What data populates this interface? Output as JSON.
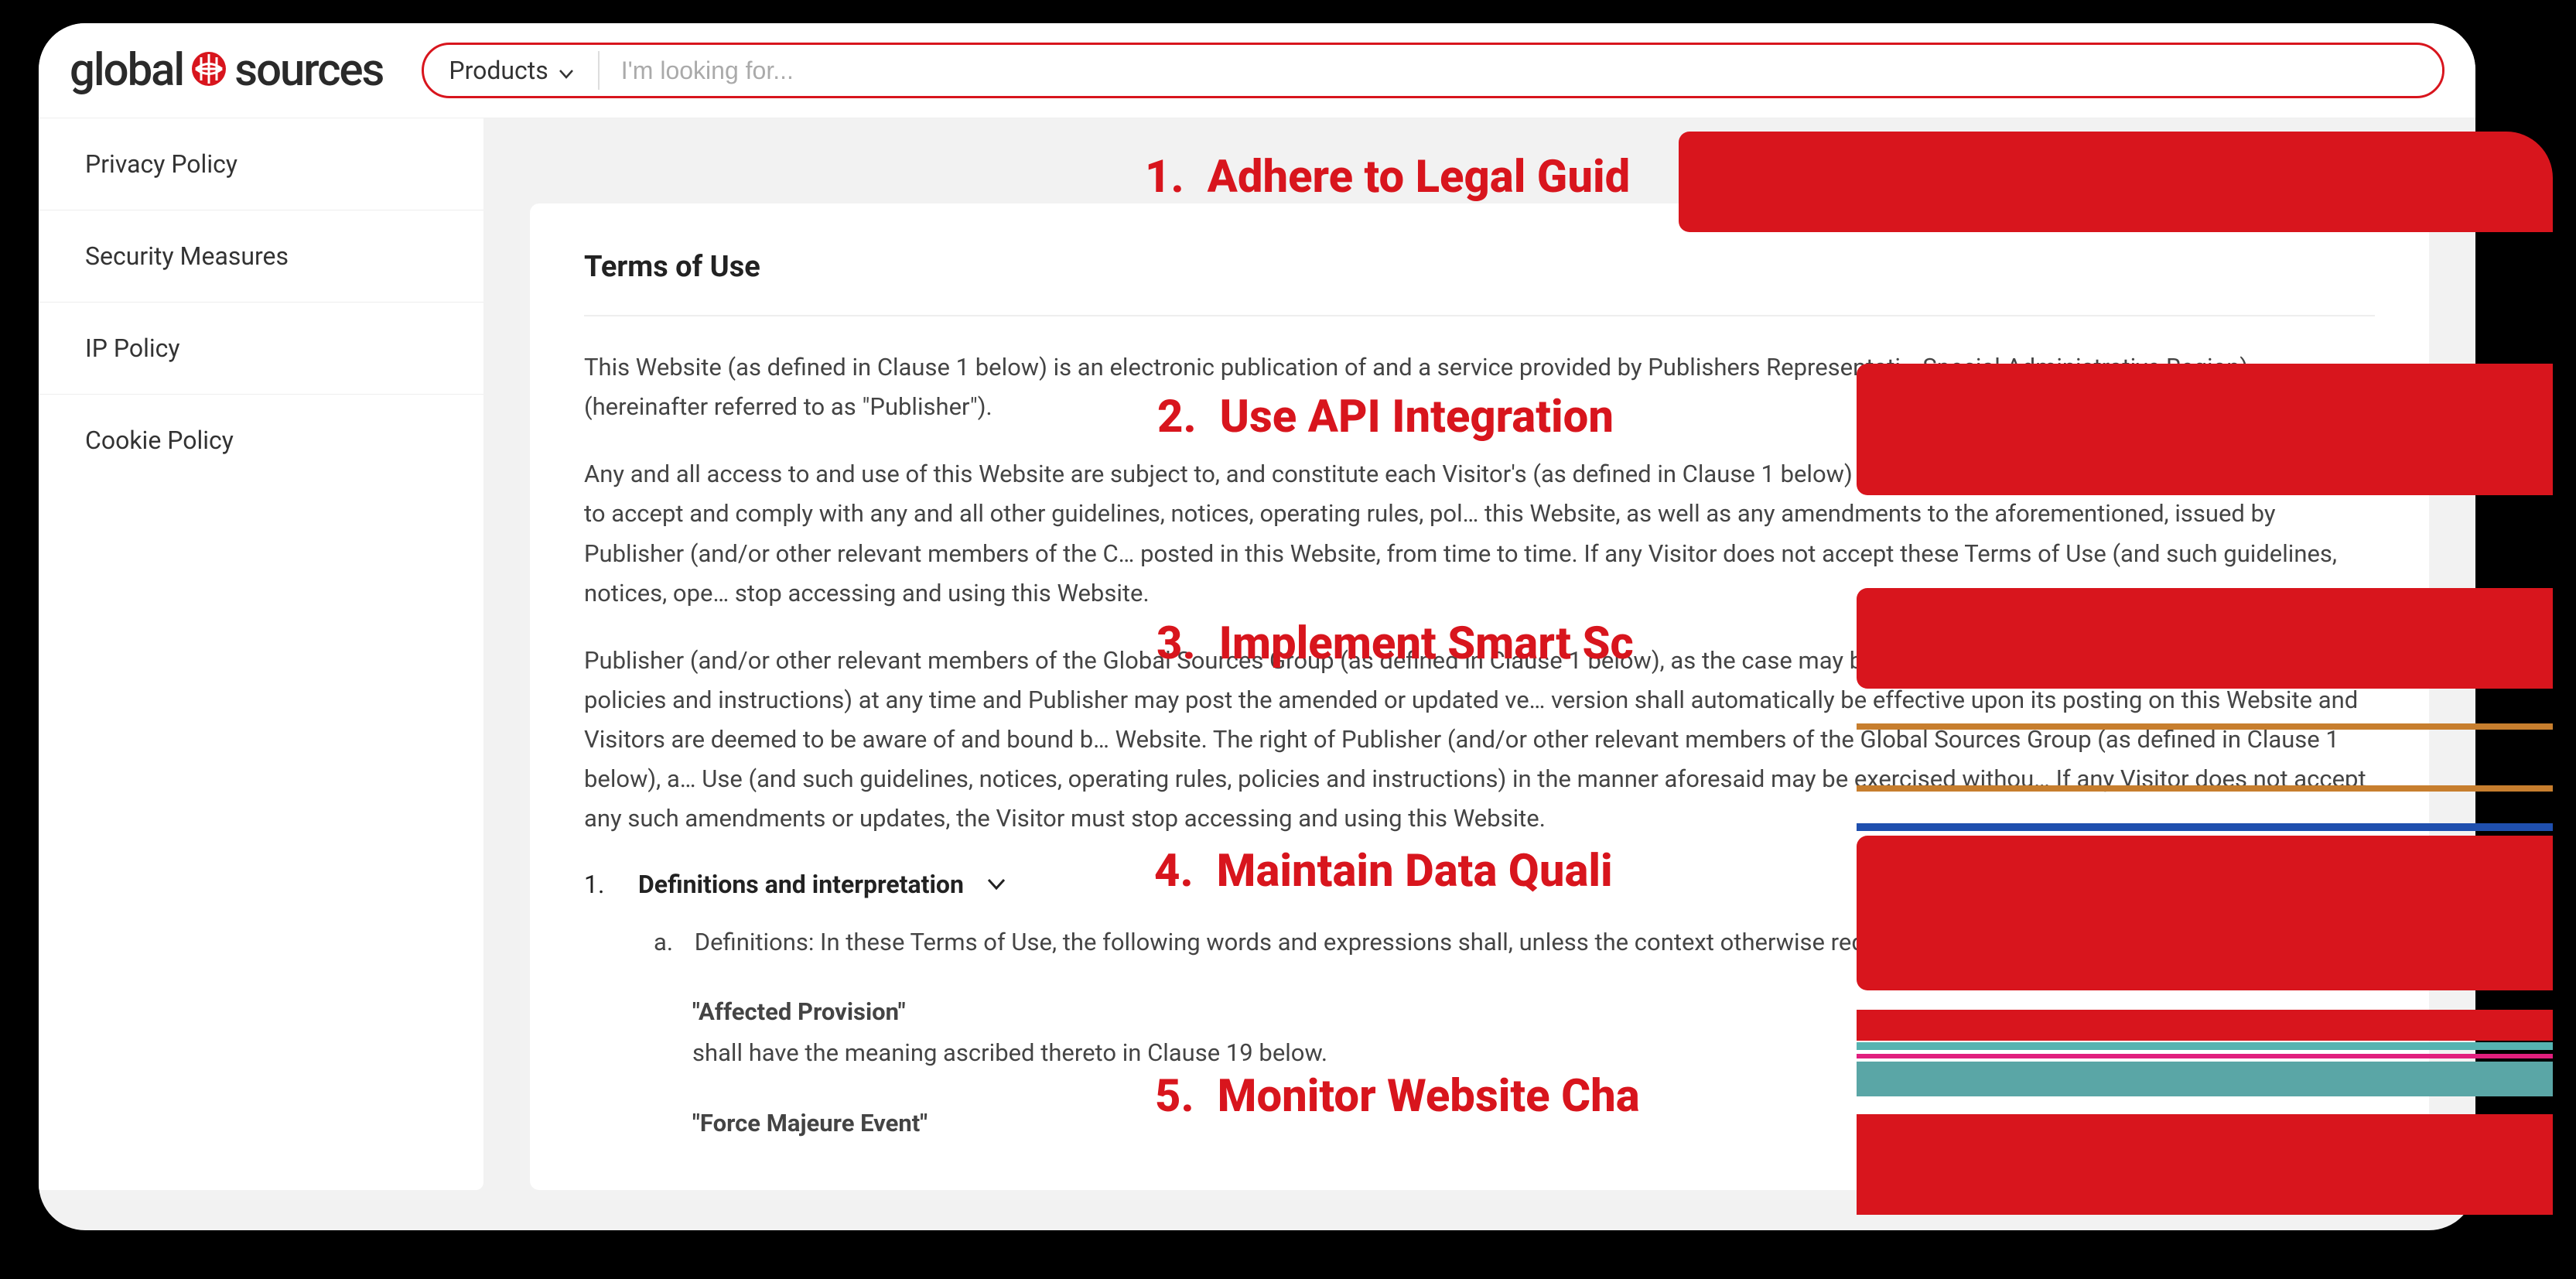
{
  "header": {
    "logo_global": "global",
    "logo_sources": "sources",
    "search_category": "Products",
    "search_placeholder": "I'm looking for..."
  },
  "sidebar": {
    "items": [
      "Privacy Policy",
      "Security Measures",
      "IP Policy",
      "Cookie Policy"
    ]
  },
  "card": {
    "title": "Terms of Use",
    "p1": "This Website (as defined in Clause 1 below) is an electronic publication of and a service provided by Publishers Representati… Special Administrative Region) (hereinafter referred to as \"Publisher\").",
    "p2": "Any and all access to and use of this Website are subject to, and constitute each Visitor's (as defined in Clause 1 below) ackn… (\"Terms of Use\"). Each Visitor also agrees to accept and comply with any and all other guidelines, notices, operating rules, pol… this Website, as well as any amendments to the aforementioned, issued by Publisher (and/or other relevant members of the C… posted in this Website, from time to time. If any Visitor does not accept these Terms of Use (and such guidelines, notices, ope… stop accessing and using this Website.",
    "p3": "Publisher (and/or other relevant members of the Global Sources Group (as defined in Clause 1 below), as the case may be) m… guidelines, notices, operating rules, policies and instructions) at any time and Publisher may post the amended or updated ve… version shall automatically be effective upon its posting on this Website and Visitors are deemed to be aware of and bound b… Website. The right of Publisher (and/or other relevant members of the Global Sources Group (as defined in Clause 1 below), a… Use (and such guidelines, notices, operating rules, policies and instructions) in the manner aforesaid may be exercised withou… If any Visitor does not accept any such amendments or updates, the Visitor must stop accessing and using this Website.",
    "sec_num": "1.",
    "sec_title": "Definitions and interpretation",
    "sub_a_label": "a.",
    "sub_a_text": "Definitions: In these Terms of Use, the following words and expressions shall, unless the context otherwise requires,",
    "term1": "\"Affected Provision\"",
    "term1_desc": "shall have the meaning ascribed thereto in Clause 19 below.",
    "term2": "\"Force Majeure Event\""
  },
  "overlay": {
    "items": [
      {
        "num": "1.",
        "text": "Adhere to Legal Guid"
      },
      {
        "num": "2.",
        "text": "Use API Integration "
      },
      {
        "num": "3.",
        "text": "Implement Smart Sc"
      },
      {
        "num": "4.",
        "text": "Maintain Data Quali"
      },
      {
        "num": "5.",
        "text": "Monitor Website Cha"
      }
    ]
  }
}
